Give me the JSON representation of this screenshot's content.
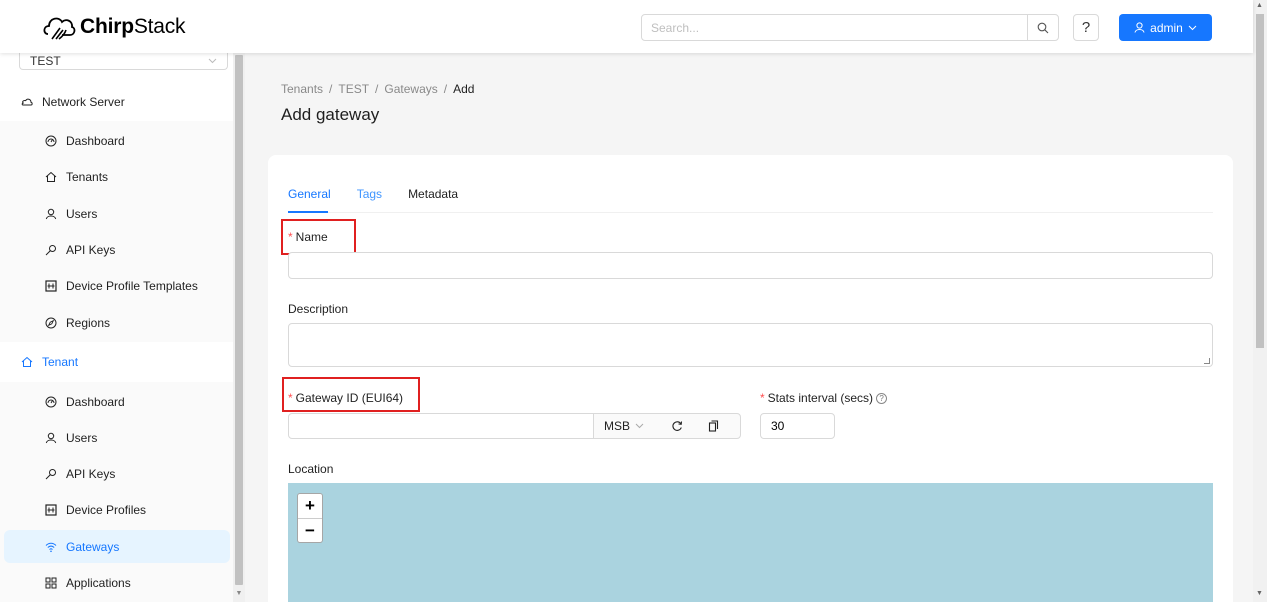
{
  "header": {
    "brand_bold": "Chirp",
    "brand_rest": "Stack",
    "search_placeholder": "Search...",
    "help_label": "?",
    "user_label": "admin"
  },
  "sidebar": {
    "tenant_select": "TEST",
    "network_server": {
      "label": "Network Server",
      "items": [
        {
          "label": "Dashboard",
          "icon": "dashboard-icon"
        },
        {
          "label": "Tenants",
          "icon": "home-icon"
        },
        {
          "label": "Users",
          "icon": "user-icon"
        },
        {
          "label": "API Keys",
          "icon": "key-icon"
        },
        {
          "label": "Device Profile Templates",
          "icon": "template-icon"
        },
        {
          "label": "Regions",
          "icon": "compass-icon"
        }
      ]
    },
    "tenant": {
      "label": "Tenant",
      "items": [
        {
          "label": "Dashboard",
          "icon": "dashboard-icon"
        },
        {
          "label": "Users",
          "icon": "user-icon"
        },
        {
          "label": "API Keys",
          "icon": "key-icon"
        },
        {
          "label": "Device Profiles",
          "icon": "template-icon"
        },
        {
          "label": "Gateways",
          "icon": "wifi-icon",
          "selected": true
        },
        {
          "label": "Applications",
          "icon": "appstore-icon"
        }
      ]
    }
  },
  "breadcrumb": [
    "Tenants",
    "TEST",
    "Gateways",
    "Add"
  ],
  "page_title": "Add gateway",
  "tabs": [
    {
      "label": "General",
      "active": true
    },
    {
      "label": "Tags"
    },
    {
      "label": "Metadata"
    }
  ],
  "form": {
    "name_label": "Name",
    "name_value": "",
    "description_label": "Description",
    "description_value": "",
    "gateway_id_label": "Gateway ID (EUI64)",
    "gateway_id_value": "",
    "byte_order": "MSB",
    "stats_interval_label": "Stats interval (secs)",
    "stats_interval_value": "30",
    "location_label": "Location",
    "zoom_in": "+",
    "zoom_out": "−"
  },
  "colors": {
    "primary": "#1677ff",
    "highlight": "#e02020",
    "map": "#aad3df"
  }
}
